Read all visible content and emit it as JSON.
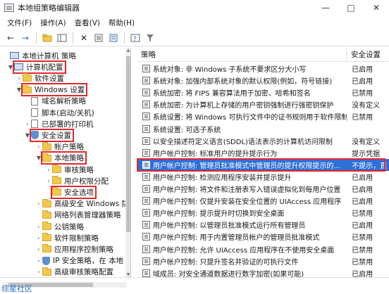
{
  "window": {
    "title": "本地组策略编辑器",
    "controls": [
      "—",
      "□",
      "✕"
    ]
  },
  "menu": [
    "文件(F)",
    "操作(A)",
    "查看(V)",
    "帮助(H)"
  ],
  "tree": {
    "items": [
      {
        "label": "本地计算机 策略",
        "icon": "computer-icon",
        "level": 0,
        "twist": "",
        "highlight": false
      },
      {
        "label": "计算机配置",
        "icon": "computer-icon",
        "level": 1,
        "twist": "▼",
        "highlight": true
      },
      {
        "label": "软件设置",
        "icon": "folder-icon",
        "level": 2,
        "twist": "›",
        "highlight": false
      },
      {
        "label": "Windows 设置",
        "icon": "folder-icon",
        "level": 2,
        "twist": "▼",
        "highlight": true
      },
      {
        "label": "域名解析策略",
        "icon": "doc-icon",
        "level": 3,
        "twist": "",
        "highlight": false
      },
      {
        "label": "脚本(启动/关机)",
        "icon": "doc-icon",
        "level": 3,
        "twist": "",
        "highlight": false
      },
      {
        "label": "已部署的打印机",
        "icon": "doc-icon",
        "level": 3,
        "twist": "›",
        "highlight": false
      },
      {
        "label": "安全设置",
        "icon": "shield-icon",
        "level": 3,
        "twist": "▼",
        "highlight": true
      },
      {
        "label": "帐户策略",
        "icon": "folder-icon",
        "level": 4,
        "twist": "›",
        "highlight": false
      },
      {
        "label": "本地策略",
        "icon": "folder-icon",
        "level": 4,
        "twist": "▼",
        "highlight": true
      },
      {
        "label": "审核策略",
        "icon": "folder-icon",
        "level": 5,
        "twist": "›",
        "highlight": false
      },
      {
        "label": "用户权限分配",
        "icon": "folder-icon",
        "level": 5,
        "twist": "›",
        "highlight": false
      },
      {
        "label": "安全选项",
        "icon": "folder-icon",
        "level": 5,
        "twist": "",
        "highlight": true
      },
      {
        "label": "高级安全 Windows 防",
        "icon": "folder-icon",
        "level": 4,
        "twist": "›",
        "highlight": false
      },
      {
        "label": "网络列表管理器策略",
        "icon": "folder-icon",
        "level": 4,
        "twist": "",
        "highlight": false
      },
      {
        "label": "公钥策略",
        "icon": "folder-icon",
        "level": 4,
        "twist": "›",
        "highlight": false
      },
      {
        "label": "软件限制策略",
        "icon": "folder-icon",
        "level": 4,
        "twist": "›",
        "highlight": false
      },
      {
        "label": "应用程序控制策略",
        "icon": "folder-icon",
        "level": 4,
        "twist": "›",
        "highlight": false
      },
      {
        "label": "IP 安全策略，在 本地",
        "icon": "shield-icon",
        "level": 4,
        "twist": "›",
        "highlight": false
      },
      {
        "label": "高级审核策略配置",
        "icon": "folder-icon",
        "level": 4,
        "twist": "›",
        "highlight": false
      }
    ]
  },
  "list": {
    "columns": [
      "策略",
      "安全设置"
    ],
    "rows": [
      {
        "name": "系统对象: 非 Windows 子系统不要求区分大小写",
        "setting": "已启用"
      },
      {
        "name": "系统对象: 加强内部系统对象的默认权限(例如，符号链接)",
        "setting": "已启用"
      },
      {
        "name": "系统加密: 将 FIPS 兼容算法用于加密、哈希和签名",
        "setting": "已禁用"
      },
      {
        "name": "系统加密: 为计算机上存储的用户密钥强制进行强密钥保护",
        "setting": "没有定义"
      },
      {
        "name": "系统设置: 将 Windows 可执行文件中的证书规则用于软件限制",
        "setting": "已禁用"
      },
      {
        "name": "系统设置: 可选子系统",
        "setting": ""
      },
      {
        "name": "以安全描述符定义语言(SDDL)语法表示的计算机访问限制",
        "setting": "没有定义"
      },
      {
        "name": "用户帐户控制: 标准用户的提升提示行为",
        "setting": "提示凭据"
      },
      {
        "name": "用户帐户控制: 管理员批准模式中管理员的提升权限提示的...",
        "setting": "不提示，直"
      },
      {
        "name": "用户帐户控制: 检测应用程序安装并提示提升",
        "setting": "已启用"
      },
      {
        "name": "用户帐户控制: 将文件和注册表写入错误虚拟化到每用户位置",
        "setting": "已启用"
      },
      {
        "name": "用户帐户控制: 仅提升安装在安全位置的 UIAccess 应用程序",
        "setting": "已启用"
      },
      {
        "name": "用户帐户控制: 提示提升时切换到安全桌面",
        "setting": "已禁用"
      },
      {
        "name": "用户帐户控制: 以管理员批准模式运行所有管理员",
        "setting": "已启用"
      },
      {
        "name": "用户帐户控制: 用于内置管理员帐户的管理员批准模式",
        "setting": "已禁用"
      },
      {
        "name": "用户帐户控制: 允许 UIAccess 应用程序在不使用安全桌面",
        "setting": "已禁用"
      },
      {
        "name": "用户帐户控制: 只提升签名并验证的可执行文件",
        "setting": "已禁用"
      },
      {
        "name": "域成员: 对安全通道数据进行数字加密(如果可能)",
        "setting": "已启用"
      }
    ],
    "selected_index": 8
  },
  "watermark": "综星社区"
}
